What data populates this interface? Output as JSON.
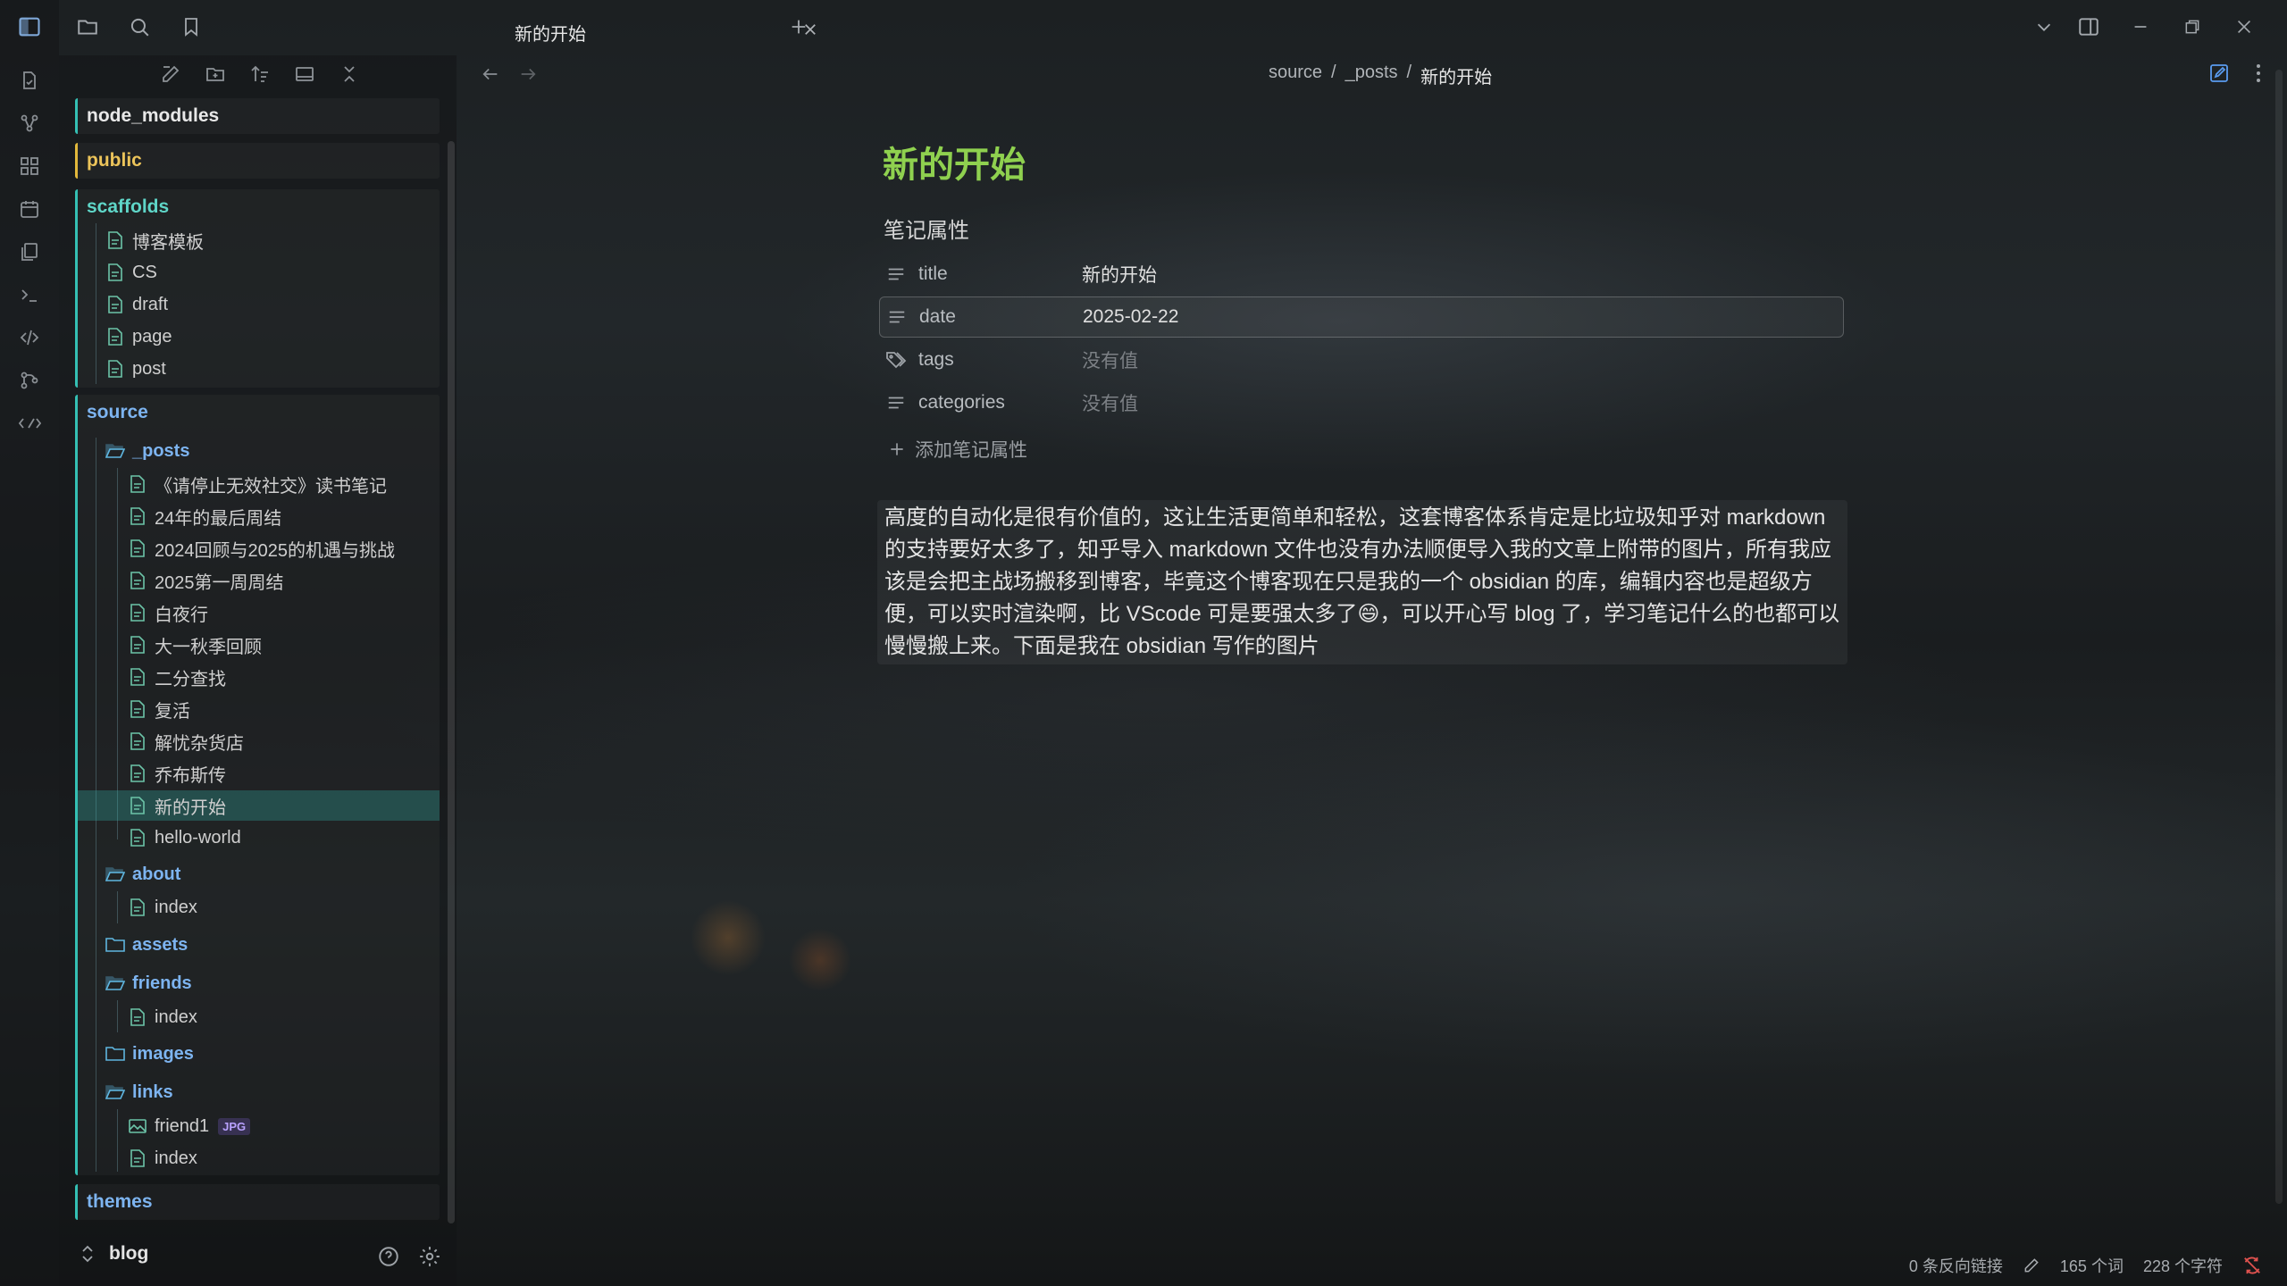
{
  "tab": {
    "title": "新的开始"
  },
  "breadcrumb": {
    "parts": [
      "source",
      "_posts",
      "新的开始"
    ],
    "sep": "/"
  },
  "sidebar": {
    "groups": {
      "node_modules": "node_modules",
      "public": "public",
      "scaffolds": "scaffolds",
      "source": "source",
      "themes": "themes"
    },
    "scaffolds_items": [
      "博客模板",
      "CS",
      "draft",
      "page",
      "post"
    ],
    "posts_folder": "_posts",
    "posts_items": [
      "《请停止无效社交》读书笔记",
      "24年的最后周结",
      "2024回顾与2025的机遇与挑战",
      "2025第一周周结",
      "白夜行",
      "大一秋季回顾",
      "二分查找",
      "复活",
      "解忧杂货店",
      "乔布斯传",
      "新的开始",
      "hello-world"
    ],
    "about": {
      "folder": "about",
      "items": [
        "index"
      ]
    },
    "assets": {
      "folder": "assets"
    },
    "friends": {
      "folder": "friends",
      "items": [
        "index"
      ]
    },
    "images": {
      "folder": "images"
    },
    "links": {
      "folder": "links",
      "items": [
        "friend1",
        "index"
      ],
      "badge": "JPG"
    },
    "vault_name": "blog"
  },
  "note": {
    "title": "新的开始",
    "properties_heading": "笔记属性",
    "properties": [
      {
        "key": "title",
        "value": "新的开始",
        "icon": "list-icon"
      },
      {
        "key": "date",
        "value": "2025-02-22",
        "icon": "list-icon"
      },
      {
        "key": "tags",
        "value": "没有值",
        "icon": "tags-icon"
      },
      {
        "key": "categories",
        "value": "没有值",
        "icon": "list-icon"
      }
    ],
    "add_property": "添加笔记属性",
    "body": "高度的自动化是很有价值的，这让生活更简单和轻松，这套博客体系肯定是比垃圾知乎对 markdown 的支持要好太多了，知乎导入 markdown 文件也没有办法顺便导入我的文章上附带的图片，所有我应该是会把主战场搬移到博客，毕竟这个博客现在只是我的一个 obsidian 的库，编辑内容也是超级方便，可以实时渲染啊，比 VScode 可是要强太多了😄，可以开心写 blog 了，学习笔记什么的也都可以慢慢搬上来。下面是我在 obsidian 写作的图片"
  },
  "status": {
    "backlinks": "0 条反向链接",
    "words": "165 个词",
    "chars": "228 个字符"
  },
  "colors": {
    "accent_teal": "#34c0b4",
    "title_green": "#8fd14f",
    "folder_gold": "#e2b83b"
  }
}
